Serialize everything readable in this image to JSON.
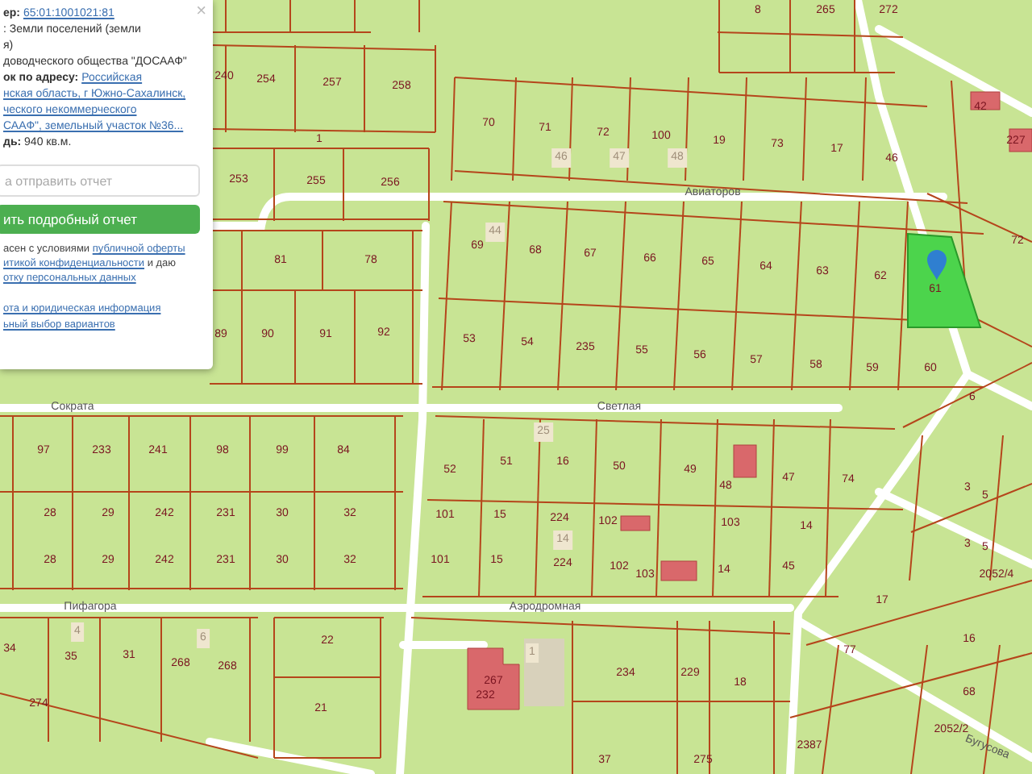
{
  "info_panel": {
    "close": "×",
    "lines": [
      {
        "kind": "label_link",
        "label": "ер:",
        "link": "65:01:1001021:81"
      },
      {
        "kind": "text",
        "text": ": Земли поселений (земли"
      },
      {
        "kind": "text",
        "text": "я)"
      },
      {
        "kind": "text",
        "text": "доводческого общества \"ДОСААФ\""
      },
      {
        "kind": "label_link",
        "label": "ок по адресу:",
        "link": "Российская"
      },
      {
        "kind": "link",
        "link": "нская область, г Южно-Сахалинск,"
      },
      {
        "kind": "link",
        "link": "ческого некоммерческого"
      },
      {
        "kind": "link",
        "link": "САAФ\", земельный участок №36..."
      },
      {
        "kind": "label_text",
        "label": "дь:",
        "text": "940 кв.м."
      }
    ],
    "email_placeholder": "а отправить отчет",
    "button": "ить подробный отчет",
    "consent": [
      {
        "text": "асен с условиями ",
        "link": "публичной оферты"
      },
      {
        "link": "итикой конфиденциальности",
        "after": " и даю"
      },
      {
        "link": "отку персональных данных"
      }
    ],
    "footer_links": [
      "ота и юридическая информация",
      "ьный выбор вариантов"
    ]
  },
  "map": {
    "streets": [
      {
        "name": "Авиаторов"
      },
      {
        "name": "Сократа"
      },
      {
        "name": "Светлая"
      },
      {
        "name": "Пифагора"
      },
      {
        "name": "Аэродромная"
      },
      {
        "name": "Бугусова"
      }
    ],
    "parcels": [
      {
        "label": "8",
        "kind": "number"
      },
      {
        "label": "265",
        "kind": "number"
      },
      {
        "label": "272",
        "kind": "number"
      },
      {
        "label": "240",
        "kind": "number"
      },
      {
        "label": "254",
        "kind": "number"
      },
      {
        "label": "257",
        "kind": "number"
      },
      {
        "label": "258",
        "kind": "number"
      },
      {
        "label": "1",
        "kind": "number"
      },
      {
        "label": "253",
        "kind": "number"
      },
      {
        "label": "255",
        "kind": "number"
      },
      {
        "label": "256",
        "kind": "number"
      },
      {
        "label": "70",
        "kind": "number"
      },
      {
        "label": "71",
        "kind": "number"
      },
      {
        "label": "46",
        "kind": "tag"
      },
      {
        "label": "72",
        "kind": "number"
      },
      {
        "label": "47",
        "kind": "tag"
      },
      {
        "label": "100",
        "kind": "number"
      },
      {
        "label": "48",
        "kind": "tag"
      },
      {
        "label": "19",
        "kind": "number"
      },
      {
        "label": "73",
        "kind": "number"
      },
      {
        "label": "17",
        "kind": "number"
      },
      {
        "label": "46",
        "kind": "number"
      },
      {
        "label": "42",
        "kind": "number"
      },
      {
        "label": "227",
        "kind": "number"
      },
      {
        "label": "72",
        "kind": "number"
      },
      {
        "label": "44",
        "kind": "tag"
      },
      {
        "label": "69",
        "kind": "number"
      },
      {
        "label": "68",
        "kind": "number"
      },
      {
        "label": "67",
        "kind": "number"
      },
      {
        "label": "66",
        "kind": "number"
      },
      {
        "label": "65",
        "kind": "number"
      },
      {
        "label": "64",
        "kind": "number"
      },
      {
        "label": "63",
        "kind": "number"
      },
      {
        "label": "62",
        "kind": "number"
      },
      {
        "label": "61",
        "kind": "number"
      },
      {
        "label": "53",
        "kind": "number"
      },
      {
        "label": "54",
        "kind": "number"
      },
      {
        "label": "235",
        "kind": "number"
      },
      {
        "label": "55",
        "kind": "number"
      },
      {
        "label": "56",
        "kind": "number"
      },
      {
        "label": "57",
        "kind": "number"
      },
      {
        "label": "58",
        "kind": "number"
      },
      {
        "label": "59",
        "kind": "number"
      },
      {
        "label": "60",
        "kind": "number"
      },
      {
        "label": "81",
        "kind": "number"
      },
      {
        "label": "78",
        "kind": "number"
      },
      {
        "label": "89",
        "kind": "number"
      },
      {
        "label": "90",
        "kind": "number"
      },
      {
        "label": "91",
        "kind": "number"
      },
      {
        "label": "92",
        "kind": "number"
      },
      {
        "label": "97",
        "kind": "number"
      },
      {
        "label": "233",
        "kind": "number"
      },
      {
        "label": "241",
        "kind": "number"
      },
      {
        "label": "98",
        "kind": "number"
      },
      {
        "label": "99",
        "kind": "number"
      },
      {
        "label": "84",
        "kind": "number"
      },
      {
        "label": "28",
        "kind": "number"
      },
      {
        "label": "29",
        "kind": "number"
      },
      {
        "label": "242",
        "kind": "number"
      },
      {
        "label": "231",
        "kind": "number"
      },
      {
        "label": "30",
        "kind": "number"
      },
      {
        "label": "32",
        "kind": "number"
      },
      {
        "label": "28",
        "kind": "number"
      },
      {
        "label": "29",
        "kind": "number"
      },
      {
        "label": "242",
        "kind": "number"
      },
      {
        "label": "231",
        "kind": "number"
      },
      {
        "label": "30",
        "kind": "number"
      },
      {
        "label": "32",
        "kind": "number"
      },
      {
        "label": "25",
        "kind": "tag"
      },
      {
        "label": "52",
        "kind": "number"
      },
      {
        "label": "51",
        "kind": "number"
      },
      {
        "label": "16",
        "kind": "number"
      },
      {
        "label": "50",
        "kind": "number"
      },
      {
        "label": "49",
        "kind": "number"
      },
      {
        "label": "48",
        "kind": "number"
      },
      {
        "label": "47",
        "kind": "number"
      },
      {
        "label": "74",
        "kind": "number"
      },
      {
        "label": "101",
        "kind": "number"
      },
      {
        "label": "15",
        "kind": "number"
      },
      {
        "label": "224",
        "kind": "number"
      },
      {
        "label": "102",
        "kind": "number"
      },
      {
        "label": "103",
        "kind": "number"
      },
      {
        "label": "14",
        "kind": "number"
      },
      {
        "label": "101",
        "kind": "number"
      },
      {
        "label": "15",
        "kind": "number"
      },
      {
        "label": "14",
        "kind": "tag"
      },
      {
        "label": "224",
        "kind": "number"
      },
      {
        "label": "102",
        "kind": "number"
      },
      {
        "label": "103",
        "kind": "number"
      },
      {
        "label": "14",
        "kind": "number"
      },
      {
        "label": "45",
        "kind": "number"
      },
      {
        "label": "6",
        "kind": "number"
      },
      {
        "label": "3",
        "kind": "number"
      },
      {
        "label": "5",
        "kind": "number"
      },
      {
        "label": "3",
        "kind": "number"
      },
      {
        "label": "5",
        "kind": "number"
      },
      {
        "label": "2052/4",
        "kind": "number"
      },
      {
        "label": "17",
        "kind": "number"
      },
      {
        "label": "16",
        "kind": "number"
      },
      {
        "label": "77",
        "kind": "number"
      },
      {
        "label": "68",
        "kind": "number"
      },
      {
        "label": "2387",
        "kind": "number"
      },
      {
        "label": "2052/2",
        "kind": "number"
      },
      {
        "label": "4",
        "kind": "tag"
      },
      {
        "label": "34",
        "kind": "number"
      },
      {
        "label": "35",
        "kind": "number"
      },
      {
        "label": "31",
        "kind": "number"
      },
      {
        "label": "6",
        "kind": "tag"
      },
      {
        "label": "268",
        "kind": "number"
      },
      {
        "label": "268",
        "kind": "number"
      },
      {
        "label": "22",
        "kind": "number"
      },
      {
        "label": "21",
        "kind": "number"
      },
      {
        "label": "274",
        "kind": "number"
      },
      {
        "label": "1",
        "kind": "tag"
      },
      {
        "label": "267",
        "kind": "number"
      },
      {
        "label": "232",
        "kind": "number"
      },
      {
        "label": "234",
        "kind": "number"
      },
      {
        "label": "229",
        "kind": "number"
      },
      {
        "label": "18",
        "kind": "number"
      },
      {
        "label": "37",
        "kind": "number"
      },
      {
        "label": "275",
        "kind": "number"
      }
    ]
  }
}
